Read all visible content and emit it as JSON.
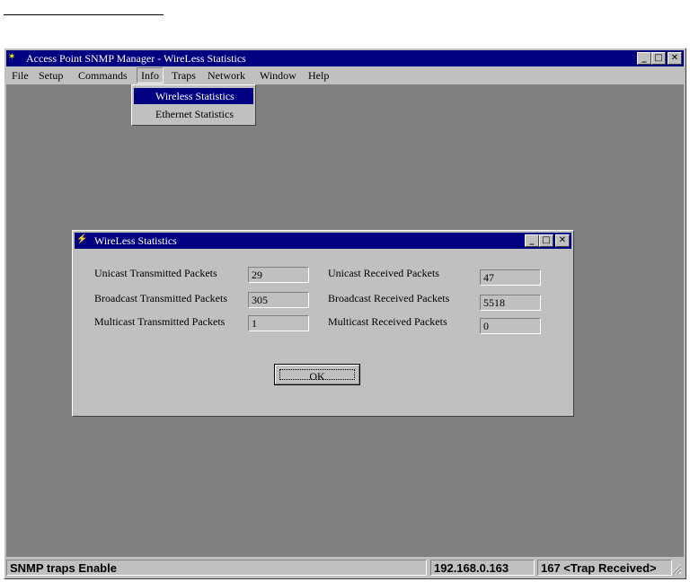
{
  "window": {
    "title": "Access Point SNMP Manager -  WireLess Statistics",
    "icon": "app-icon"
  },
  "menubar": {
    "items": [
      {
        "label": "File"
      },
      {
        "label": "Setup"
      },
      {
        "label": "Commands"
      },
      {
        "label": "Info"
      },
      {
        "label": "Traps"
      },
      {
        "label": "Network"
      },
      {
        "label": "Window"
      },
      {
        "label": "Help"
      }
    ]
  },
  "info_menu": {
    "items": [
      {
        "label": "Wireless Statistics",
        "selected": true
      },
      {
        "label": "Ethernet Statistics",
        "selected": false
      }
    ]
  },
  "dialog": {
    "title": "WireLess Statistics",
    "rows": [
      {
        "tx_label": "Unicast Transmitted Packets",
        "tx_value": "29",
        "rx_label": "Unicast Received Packets",
        "rx_value": "47"
      },
      {
        "tx_label": "Broadcast Transmitted Packets",
        "tx_value": "305",
        "rx_label": "Broadcast Received Packets",
        "rx_value": "5518"
      },
      {
        "tx_label": "Multicast Transmitted Packets",
        "tx_value": "1",
        "rx_label": "Multicast Received Packets",
        "rx_value": "0"
      }
    ],
    "ok_label": "OK"
  },
  "statusbar": {
    "status": "SNMP traps Enable",
    "ip": "192.168.0.163",
    "traps": "167 <Trap Received>"
  },
  "colors": {
    "titlebar": "#000080",
    "face": "#c0c0c0",
    "client": "#808080"
  }
}
